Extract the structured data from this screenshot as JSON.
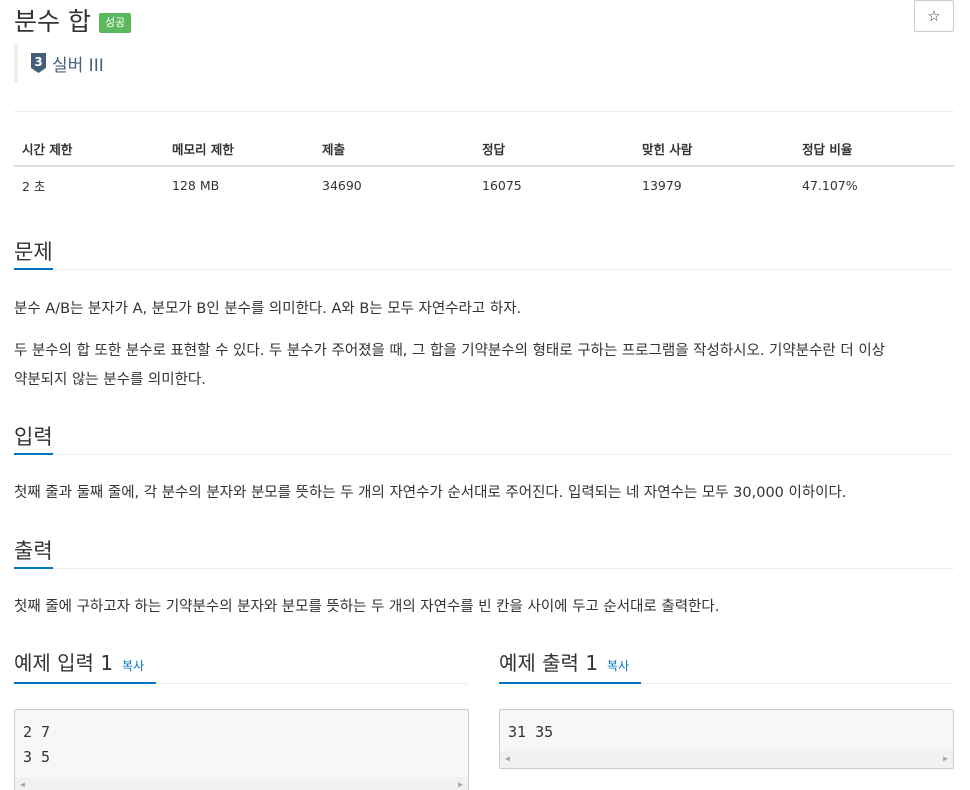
{
  "problem": {
    "title": "분수 합",
    "result_badge": "성공",
    "star_label": "☆",
    "tier": {
      "number": "3",
      "label": "실버 III",
      "color": "#435f7a"
    }
  },
  "stats": {
    "headers": [
      "시간 제한",
      "메모리 제한",
      "제출",
      "정답",
      "맞힌 사람",
      "정답 비율"
    ],
    "values": [
      "2 초",
      "128 MB",
      "34690",
      "16075",
      "13979",
      "47.107%"
    ]
  },
  "sections": {
    "description": {
      "title": "문제",
      "lines": [
        "분수 A/B는 분자가 A, 분모가 B인 분수를 의미한다. A와 B는 모두 자연수라고 하자.",
        "두 분수의 합 또한 분수로 표현할 수 있다. 두 분수가 주어졌을 때, 그 합을 기약분수의 형태로 구하는 프로그램을 작성하시오. 기약분수란 더 이상",
        "약분되지 않는 분수를 의미한다."
      ]
    },
    "input": {
      "title": "입력",
      "text": "첫째 줄과 둘째 줄에, 각 분수의 분자와 분모를 뜻하는 두 개의 자연수가 순서대로 주어진다. 입력되는 네 자연수는 모두 30,000 이하이다."
    },
    "output": {
      "title": "출력",
      "text": "첫째 줄에 구하고자 하는 기약분수의 분자와 분모를 뜻하는 두 개의 자연수를 빈 칸을 사이에 두고 순서대로 출력한다."
    }
  },
  "examples": {
    "input": {
      "label": "예제 입력 1",
      "copy_label": "복사",
      "lines": [
        "2 7",
        "3 5"
      ]
    },
    "output": {
      "label": "예제 출력 1",
      "copy_label": "복사",
      "lines": [
        "31 35"
      ]
    }
  },
  "colors": {
    "accent": "#0076c0",
    "success": "#5cb85c",
    "tier": "#435f7a"
  }
}
